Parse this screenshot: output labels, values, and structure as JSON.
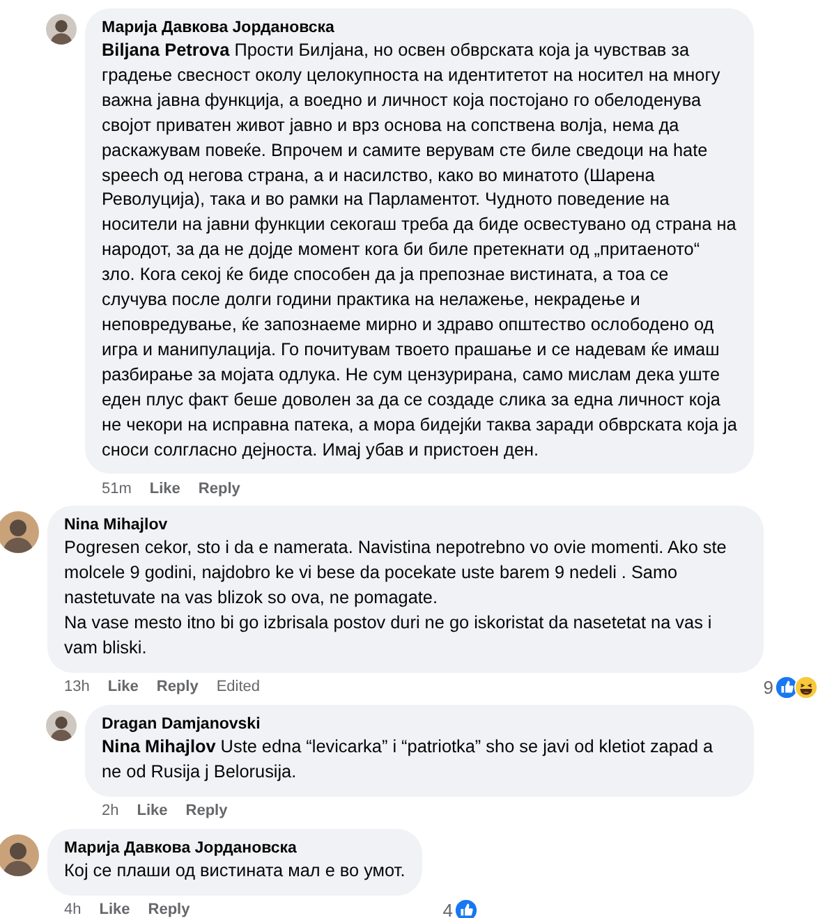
{
  "comments": [
    {
      "kind": "reply",
      "author": "Марија Давкова Јордановска",
      "text": "**Biljana Petrova** Прости Билјана, но освен обврската која ја чувствав за градење свесност околу целокупноста на идентитетот на носител на многу важна јавна функција, а воедно и личност која постојано го обелоденува својот приватен живот јавно и врз основа на сопствена волја, нема да раскажувам повеќе. Впрочем и самите верувам сте биле сведоци на hate speech од негова страна, а и насилство, како во минатото (Шарена Револуција), така и во рамки на Парламентот. Чудното поведение на носители на јавни функции секогаш треба да биде освестувано од страна на народот, за да не дојде момент кога би биле претекнати од „притаеното“ зло. Кога секој ќе биде способен да ја препознае вистината, а тоа се случува после долги години практика на нелажење, некрадење и неповредување, ќе запознаеме мирно и здраво општество ослободено од игра и манипулација. Го почитувам твоето прашање и се надевам ќе имаш разбирање за мојата одлука. Не сум цензурирана, само мислам дека уште еден плус факт беше доволен за да се создаде слика за една личност која не чекори на исправна патека, а мора бидејќи таква заради обврската која ја сноси солгласно дејноста. Имај убав и пристоен ден.",
      "time": "51m",
      "actions": [
        "Like",
        "Reply"
      ]
    },
    {
      "kind": "comment",
      "author": "Nina Mihajlov",
      "text": "Pogresen cekor, sto i da e namerata. Navistina nepotrebno vo ovie momenti. Ako ste molcele 9 godini, najdobro ke vi bese da pocekate uste barem 9 nedeli . Samo nastetuvate na vas blizok so ova, ne pomagate.\nNa vase mesto itno bi go izbrisala postov duri ne go iskoristat da nasetetat na vas i vam bliski.",
      "time": "13h",
      "actions": [
        "Like",
        "Reply"
      ],
      "edited": "Edited",
      "reactions": {
        "count": "9",
        "icons": [
          {
            "kind": "like"
          },
          {
            "kind": "haha"
          }
        ]
      }
    },
    {
      "kind": "reply",
      "author": "Dragan Damjanovski",
      "text": "**Nina Mihajlov** Uste edna “levicarka” i “patriotka” sho se javi od kletiot zapad a ne od Rusija j Belorusija.",
      "time": "2h",
      "actions": [
        "Like",
        "Reply"
      ]
    },
    {
      "kind": "comment",
      "author": "Марија Давкова Јордановска",
      "text": "Кој се плаши од вистината мал е во умот.",
      "time": "4h",
      "actions": [
        "Like",
        "Reply"
      ],
      "reactions": {
        "count": "4",
        "icons": [
          {
            "kind": "like"
          }
        ]
      }
    }
  ]
}
